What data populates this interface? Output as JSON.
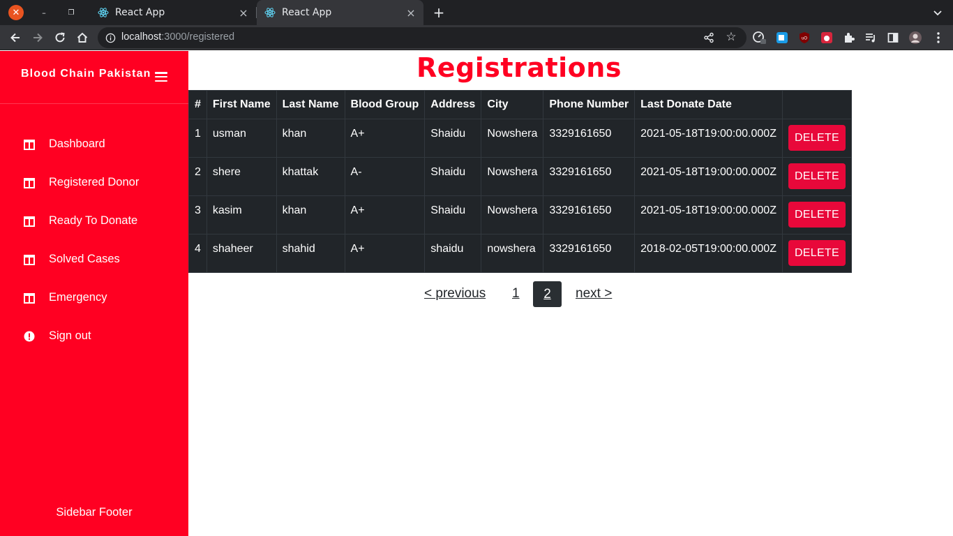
{
  "browser": {
    "tabs": [
      {
        "title": "React App"
      },
      {
        "title": "React App",
        "active": true
      }
    ],
    "url_host": "localhost",
    "url_path": ":3000/registered"
  },
  "sidebar": {
    "brand": "Blood Chain Pakistan",
    "items": [
      {
        "label": "Dashboard",
        "icon": "table-icon"
      },
      {
        "label": "Registered Donor",
        "icon": "table-icon"
      },
      {
        "label": "Ready To Donate",
        "icon": "table-icon"
      },
      {
        "label": "Solved Cases",
        "icon": "table-icon"
      },
      {
        "label": "Emergency",
        "icon": "table-icon"
      },
      {
        "label": "Sign out",
        "icon": "alert-circle-icon"
      }
    ],
    "footer": "Sidebar Footer"
  },
  "main": {
    "title": "Registrations",
    "table": {
      "headers": [
        "#",
        "First Name",
        "Last Name",
        "Blood Group",
        "Address",
        "City",
        "Phone Number",
        "Last Donate Date",
        ""
      ],
      "rows": [
        [
          "1",
          "usman",
          "khan",
          "A+",
          "Shaidu",
          "Nowshera",
          "3329161650",
          "2021-05-18T19:00:00.000Z"
        ],
        [
          "2",
          "shere",
          "khattak",
          "A-",
          "Shaidu",
          "Nowshera",
          "3329161650",
          "2021-05-18T19:00:00.000Z"
        ],
        [
          "3",
          "kasim",
          "khan",
          "A+",
          "Shaidu",
          "Nowshera",
          "3329161650",
          "2021-05-18T19:00:00.000Z"
        ],
        [
          "4",
          "shaheer",
          "shahid",
          "A+",
          "shaidu",
          "nowshera",
          "3329161650",
          "2018-02-05T19:00:00.000Z"
        ]
      ],
      "action_label": "DELETE"
    },
    "pagination": {
      "previous": "< previous",
      "pages": [
        "1",
        "2"
      ],
      "current": "2",
      "next": "next >"
    }
  },
  "colors": {
    "brand_red": "#ff0022",
    "delete_button": "#e8083a",
    "table_bg": "#212529"
  }
}
